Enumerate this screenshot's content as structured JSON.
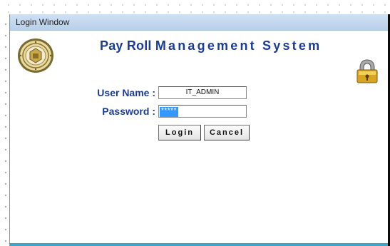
{
  "window": {
    "title": "Login Window"
  },
  "header": {
    "title_part1": "Pay Roll ",
    "title_part2": "Management System",
    "logo_icon": "seal-icon",
    "lock_icon": "padlock-icon"
  },
  "form": {
    "username_label": "User Name :",
    "username_value": "IT_ADMIN",
    "password_label": "Password :",
    "password_value": "*****"
  },
  "buttons": {
    "login": "Login",
    "cancel": "Cancel"
  },
  "colors": {
    "title_text": "#1c3d8f",
    "selection": "#3399ff",
    "titlebar": "#c5d9ef"
  }
}
